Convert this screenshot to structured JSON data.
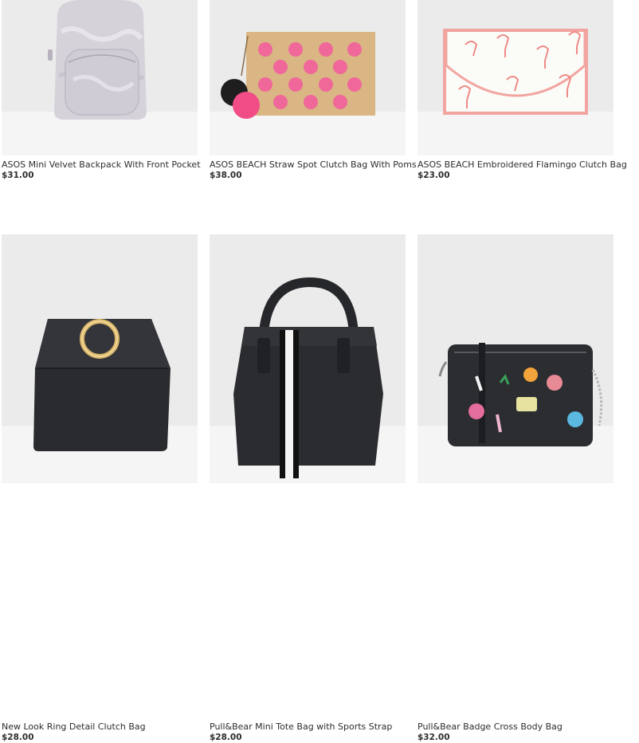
{
  "products": [
    {
      "name": "ASOS Mini Velvet Backpack With Front Pocket",
      "price": "$31.00",
      "image": "lilac-velvet-backpack"
    },
    {
      "name": "ASOS BEACH Straw Spot Clutch Bag With Poms",
      "price": "$38.00",
      "image": "straw-spot-clutch"
    },
    {
      "name": "ASOS BEACH Embroidered Flamingo Clutch Bag",
      "price": "$23.00",
      "image": "flamingo-clutch"
    },
    {
      "name": "New Look Ring Detail Clutch Bag",
      "price": "$28.00",
      "image": "black-ring-clutch"
    },
    {
      "name": "Pull&Bear Mini Tote Bag with Sports Strap",
      "price": "$28.00",
      "image": "black-tote-bag"
    },
    {
      "name": "Pull&Bear Badge Cross Body Bag",
      "price": "$32.00",
      "image": "black-badge-crossbody"
    }
  ]
}
